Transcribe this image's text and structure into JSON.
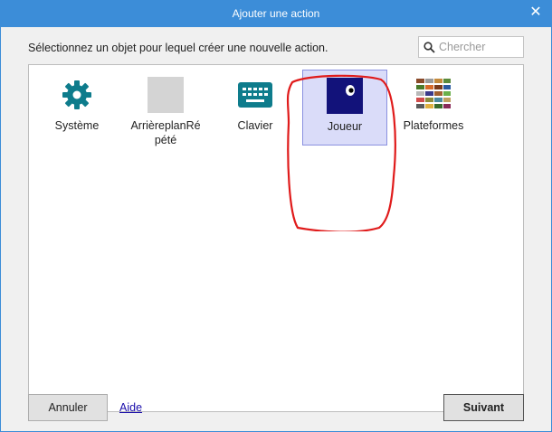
{
  "window": {
    "title": "Ajouter une action",
    "close_icon": "close-icon"
  },
  "dialog": {
    "prompt": "Sélectionnez un objet pour lequel créer une nouvelle action.",
    "search": {
      "placeholder": "Chercher",
      "value": ""
    },
    "objects": [
      {
        "label": "Système",
        "icon": "gear-icon",
        "selected": false
      },
      {
        "label": "ArrièreplanRépété",
        "icon": "blank-sprite-icon",
        "selected": false
      },
      {
        "label": "Clavier",
        "icon": "keyboard-icon",
        "selected": false
      },
      {
        "label": "Joueur",
        "icon": "player-sprite-icon",
        "selected": true
      },
      {
        "label": "Plateformes",
        "icon": "platform-tiles-icon",
        "selected": false
      }
    ],
    "buttons": {
      "cancel": "Annuler",
      "help": "Aide",
      "next": "Suivant"
    }
  },
  "colors": {
    "titlebar": "#3c8dd8",
    "selection_bg": "#dadcf9",
    "gear": "#0e7c8c",
    "keyboard": "#0e7c8c",
    "player_bg": "#12127a",
    "annotation": "#e01b1b"
  }
}
